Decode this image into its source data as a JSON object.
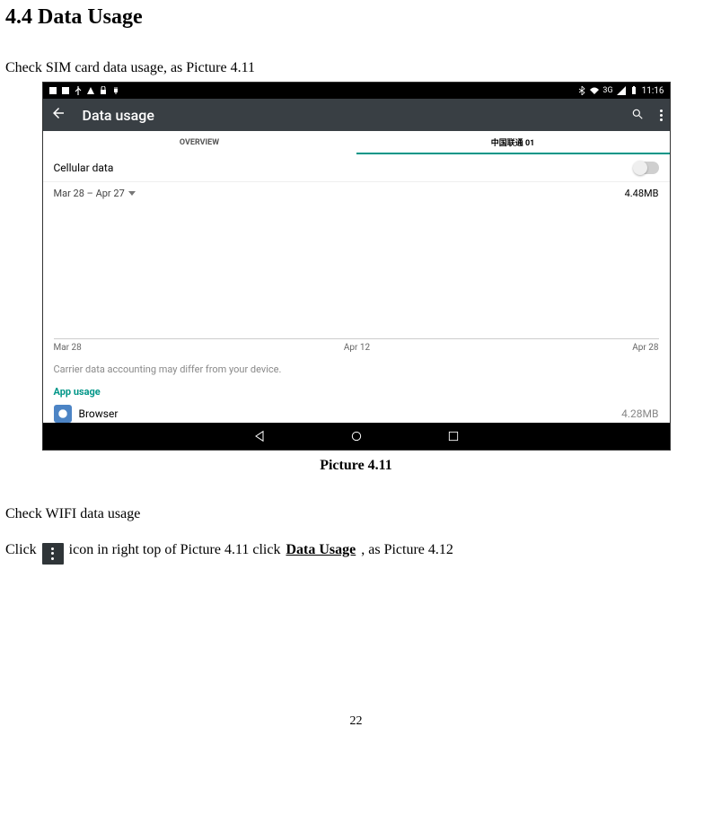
{
  "doc": {
    "heading": "4.4 Data Usage",
    "intro": "Check SIM card data usage, as Picture 4.11",
    "caption": "Picture 4.11",
    "wifi_heading": "Check WIFI data usage",
    "click_prefix": "Click ",
    "click_mid": " icon in right top of Picture 4.11 click ",
    "click_bold": "Data Usage",
    "click_suffix": ", as Picture 4.12",
    "page_number": "22"
  },
  "screenshot": {
    "status_bar": {
      "time": "11:16",
      "signal_label": "3G"
    },
    "app_bar": {
      "title": "Data usage"
    },
    "tabs": {
      "overview": "OVERVIEW",
      "sim": "中国联通 01"
    },
    "cellular_row_label": "Cellular data",
    "date_range": "Mar 28 – Apr 27",
    "total_usage": "4.48MB",
    "axis": {
      "start": "Mar 28",
      "mid": "Apr 12",
      "end": "Apr 28"
    },
    "disclaimer": "Carrier data accounting may differ from your device.",
    "app_usage_label": "App usage",
    "app_row": {
      "name": "Browser",
      "value": "4.28MB"
    }
  },
  "chart_data": {
    "type": "line",
    "categories": [
      "Mar 28",
      "Apr 12",
      "Apr 28"
    ],
    "values": [
      0,
      0,
      0
    ],
    "title": "",
    "xlabel": "",
    "ylabel": "",
    "ylim": [
      0,
      5
    ]
  }
}
